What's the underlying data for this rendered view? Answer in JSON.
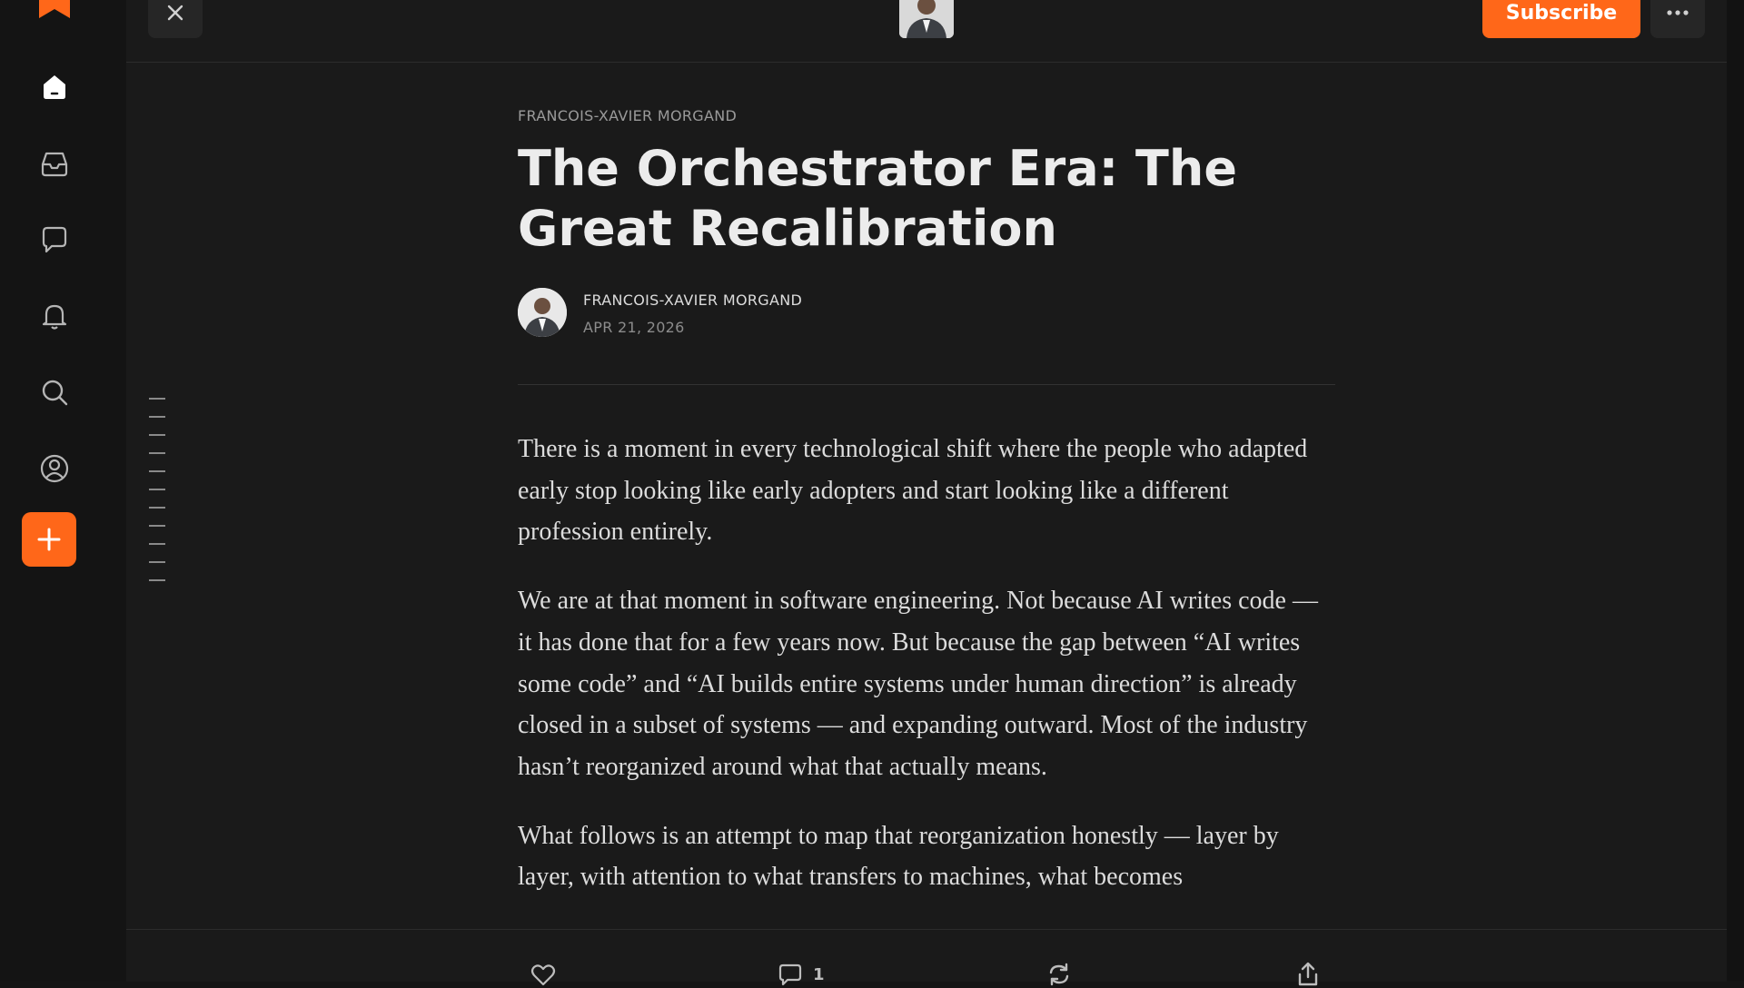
{
  "colors": {
    "accent": "#ff6719",
    "background": "#1a1a1a",
    "sidebar": "#141414",
    "text": "#e8e8e8"
  },
  "sidebar": {
    "items": [
      {
        "name": "home",
        "icon": "home-icon"
      },
      {
        "name": "inbox",
        "icon": "inbox-icon"
      },
      {
        "name": "chat",
        "icon": "chat-icon"
      },
      {
        "name": "activity",
        "icon": "bell-icon"
      },
      {
        "name": "search",
        "icon": "search-icon"
      },
      {
        "name": "profile",
        "icon": "profile-icon"
      }
    ],
    "create_icon": "plus-icon"
  },
  "topbar": {
    "close_icon": "close-icon",
    "subscribe_label": "Subscribe",
    "more_icon": "more-icon"
  },
  "article": {
    "kicker": "FRANCOIS-XAVIER MORGAND",
    "title": "The Orchestrator Era: The Great Recalibration",
    "author": "FRANCOIS-XAVIER MORGAND",
    "date": "APR 21, 2026",
    "paragraphs": [
      "There is a moment in every technological shift where the people who adapted early stop looking like early adopters and start looking like a different profession entirely.",
      "We are at that moment in software engineering. Not because AI writes code — it has done that for a few years now. But because the gap between “AI writes some code” and “AI builds entire systems under human direction” is already closed in a subset of systems — and expanding outward. Most of the industry hasn’t reorganized around what that actually means.",
      "What follows is an attempt to map that reorganization honestly — layer by layer, with attention to what transfers to machines, what becomes"
    ]
  },
  "actions": {
    "like_icon": "heart-icon",
    "comment_icon": "comment-icon",
    "comment_count": "1",
    "restack_icon": "restack-icon",
    "share_icon": "share-icon"
  }
}
